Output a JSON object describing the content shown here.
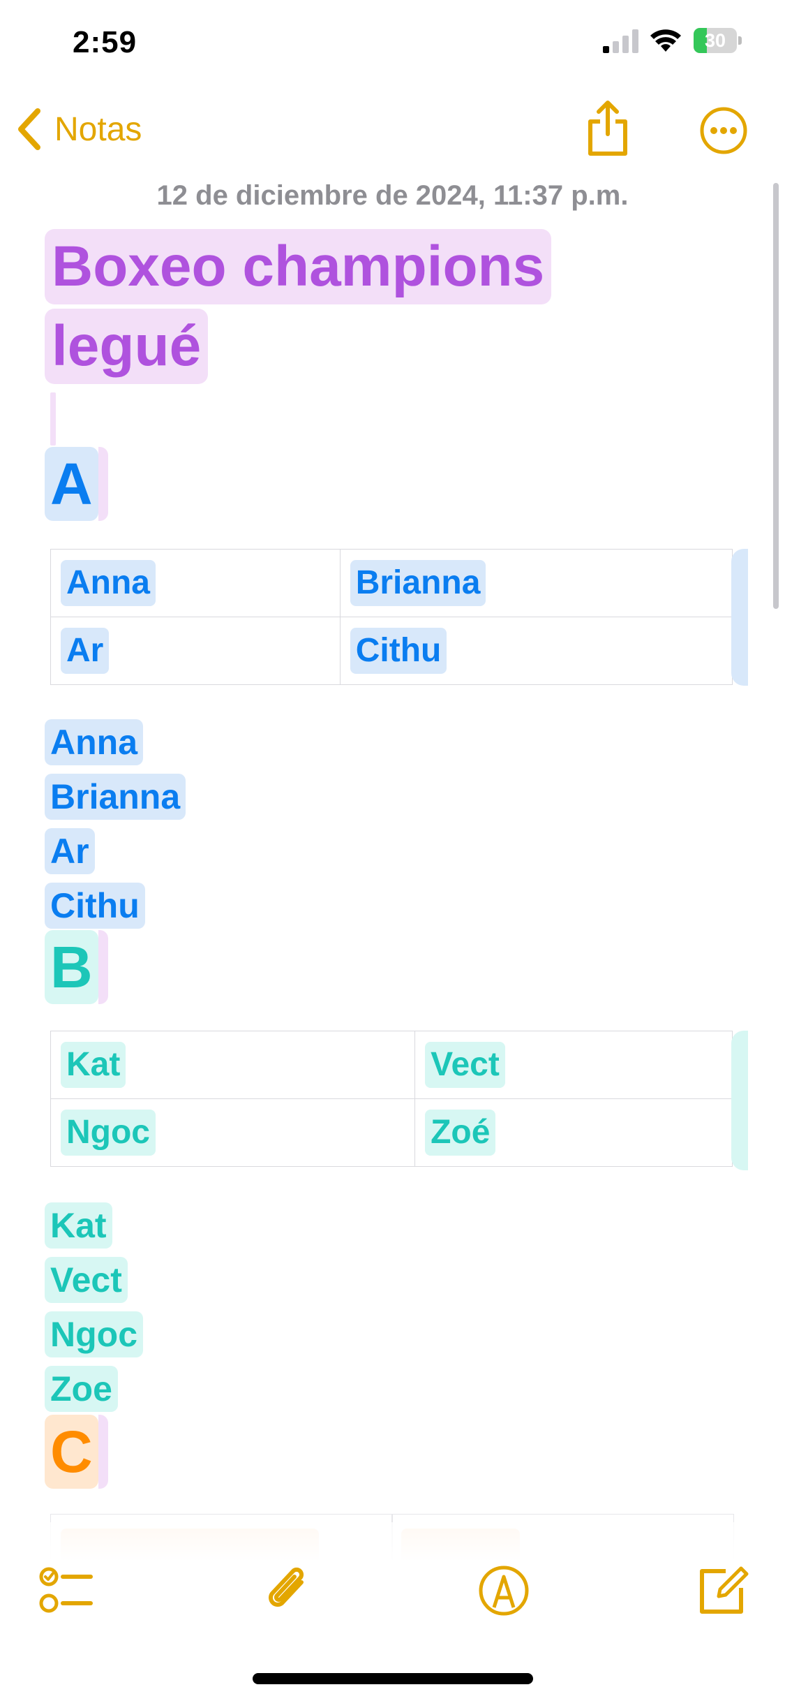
{
  "status_bar": {
    "time": "2:59",
    "battery": "30"
  },
  "nav": {
    "back_label": "Notas"
  },
  "note": {
    "date": "12 de diciembre de 2024, 11:37 p.m.",
    "title_lines": [
      "Boxeo champions",
      "legué"
    ],
    "sections": [
      {
        "letter": "A",
        "table": [
          [
            "Anna",
            "Brianna"
          ],
          [
            "Ar",
            "Cithu"
          ]
        ],
        "list": [
          "Anna",
          "Brianna",
          "Ar",
          "Cithu"
        ]
      },
      {
        "letter": "B",
        "table": [
          [
            "Kat",
            "Vect"
          ],
          [
            "Ngoc",
            "Zoé"
          ]
        ],
        "list": [
          "Kat",
          "Vect",
          "Ngoc",
          "Zoe"
        ]
      },
      {
        "letter": "C"
      }
    ]
  },
  "toolbar": {
    "icons": [
      "checklist-icon",
      "attachment-icon",
      "markup-icon",
      "compose-icon"
    ]
  },
  "colors": {
    "accent": "#e3a600",
    "purple": "#af52de",
    "blue": "#0a7df0",
    "teal": "#1cc6b8",
    "orange": "#ff8c00"
  }
}
